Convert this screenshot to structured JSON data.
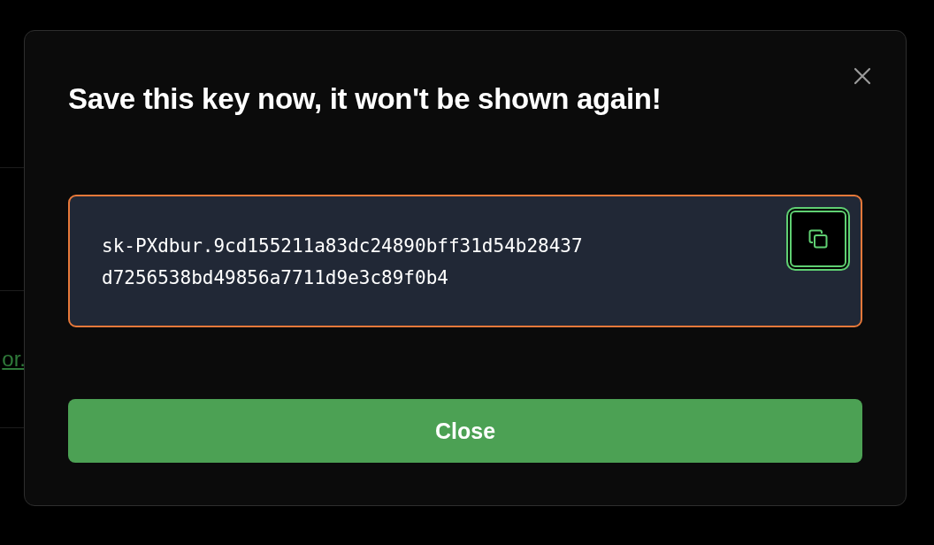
{
  "background": {
    "link": "or."
  },
  "dialog": {
    "title": "Save this key now, it won't be shown again!",
    "key_lines": [
      "sk-PXdbur.9cd155211a83dc24890bff31d54b28437",
      "d7256538bd49856a7711d9e3c89f0b4"
    ],
    "buttons": [
      {
        "label": "Close",
        "kind": "primary"
      }
    ]
  }
}
